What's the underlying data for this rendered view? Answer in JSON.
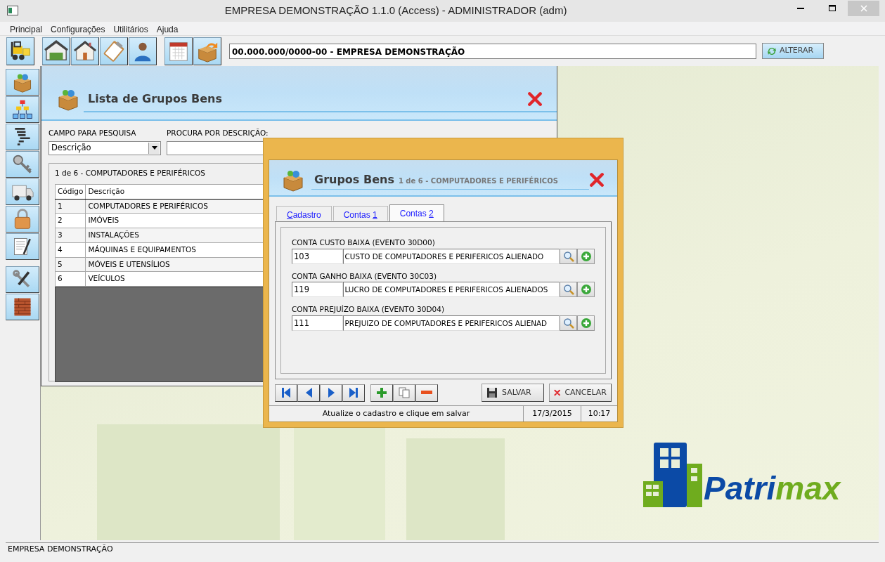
{
  "window": {
    "title": "EMPRESA DEMONSTRAÇÃO 1.1.0 (Access) - ADMINISTRADOR (adm)"
  },
  "menu": [
    "Principal",
    "Configurações",
    "Utilitários",
    "Ajuda"
  ],
  "toolbar": {
    "company": "00.000.000/0000-00 - EMPRESA DEMONSTRAÇÃO",
    "button": "ALTERAR"
  },
  "list_window": {
    "title": "Lista de Grupos Bens",
    "field_label": "CAMPO PARA PESQUISA",
    "field_value": "Descrição",
    "search_label": "PROCURA POR DESCRIÇÃO:",
    "record_info": "1 de 6 - COMPUTADORES E PERIFÉRICOS",
    "columns": [
      "Código",
      "Descrição"
    ],
    "rows": [
      [
        "1",
        "COMPUTADORES E PERIFÉRICOS"
      ],
      [
        "2",
        "IMÓVEIS"
      ],
      [
        "3",
        "INSTALAÇÕES"
      ],
      [
        "4",
        "MÁQUINAS E EQUIPAMENTOS"
      ],
      [
        "5",
        "MÓVEIS E UTENSÍLIOS"
      ],
      [
        "6",
        "VEÍCULOS"
      ]
    ]
  },
  "dialog": {
    "title": "Grupos Bens",
    "subtitle": "1 de 6 - COMPUTADORES E PERIFÉRICOS",
    "tabs": [
      {
        "label": "Cadastro",
        "accelerator_first": true,
        "selected": false
      },
      {
        "label": "Contas 1",
        "accelerator_first": false,
        "selected": false
      },
      {
        "label": "Contas 2",
        "accelerator_first": false,
        "selected": true
      }
    ],
    "fields": [
      {
        "label": "CONTA CUSTO BAIXA (EVENTO 30D00)",
        "code": "103",
        "description": "CUSTO DE COMPUTADORES E PERIFERICOS ALIENADO"
      },
      {
        "label": "CONTA GANHO BAIXA (EVENTO 30C03)",
        "code": "119",
        "description": "LUCRO DE COMPUTADORES E PERIFERICOS ALIENADOS"
      },
      {
        "label": "CONTA PREJUÍZO BAIXA (EVENTO 30D04)",
        "code": "111",
        "description": "PREJUIZO DE COMPUTADORES E PERIFERICOS ALIENAD"
      }
    ],
    "save": "SALVAR",
    "cancel": "CANCELAR",
    "status": {
      "message": "Atualize o cadastro e clique em salvar",
      "date": "17/3/2015",
      "time": "10:17"
    }
  },
  "logo": {
    "part_1": "Patri",
    "part_2": "max"
  },
  "status_bar": "EMPRESA DEMONSTRAÇÃO"
}
